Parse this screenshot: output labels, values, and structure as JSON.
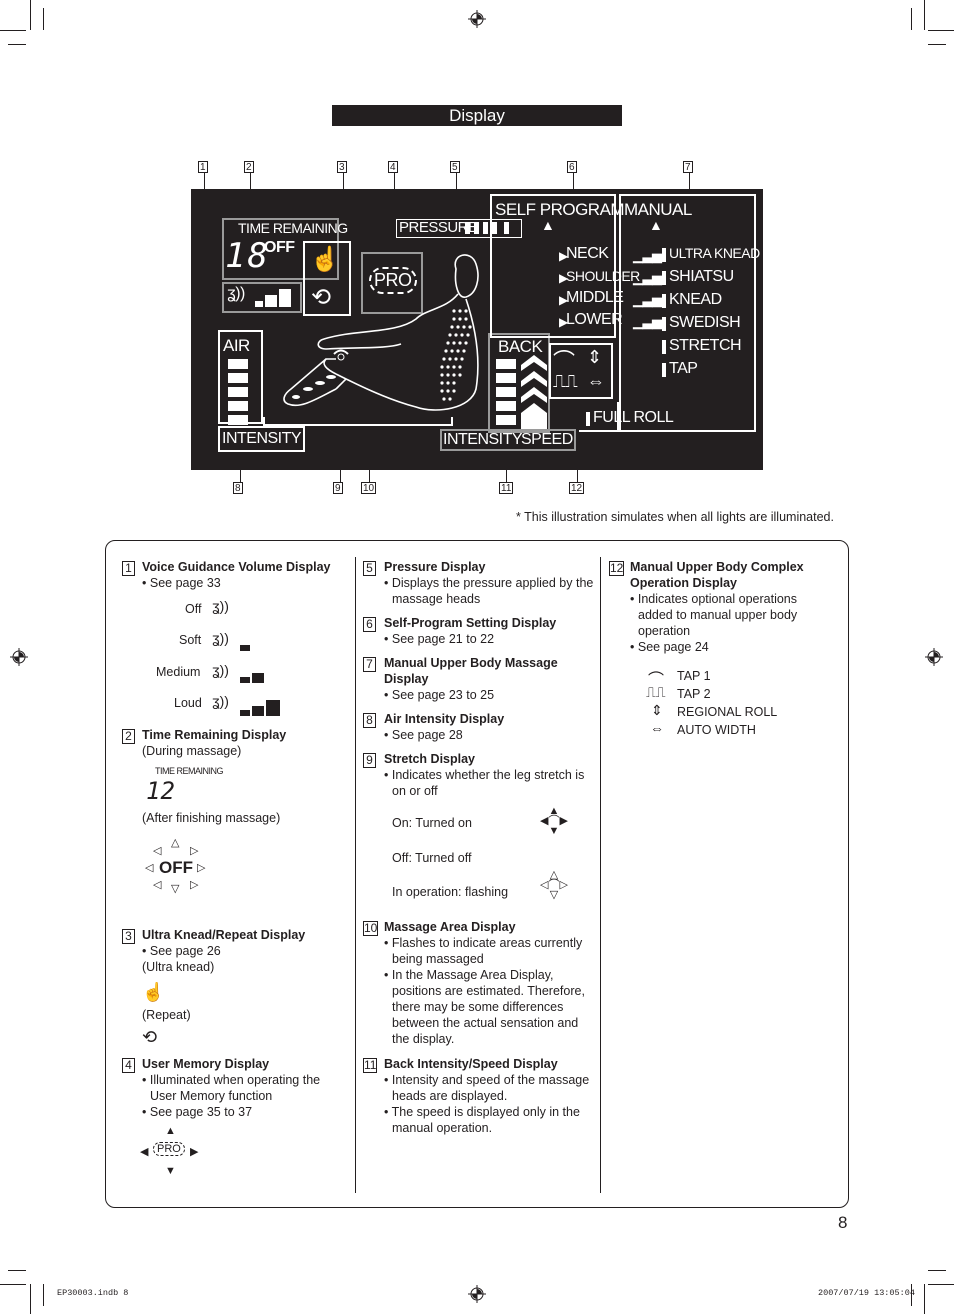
{
  "page": {
    "section_title": "Display",
    "page_number": "8",
    "note": "* This illustration simulates when all lights are illuminated.",
    "footer_left": "EP30003.indb   8",
    "footer_right": "2007/07/19   13:05:04"
  },
  "callouts": [
    "1",
    "2",
    "3",
    "4",
    "5",
    "6",
    "7",
    "8",
    "9",
    "10",
    "11",
    "12"
  ],
  "lcd": {
    "time_remaining_label": "TIME REMAINING",
    "time_digits": "18",
    "off_label": "OFF",
    "pressure_label": "PRESSURE",
    "pro_label": "PRO",
    "self_program_label": "SELF PROGRAM",
    "manual_label": "MANUAL",
    "self_program_areas": [
      "NECK",
      "SHOULDER",
      "MIDDLE",
      "LOWER"
    ],
    "manual_modes": [
      "ULTRA KNEAD",
      "SHIATSU",
      "KNEAD",
      "SWEDISH",
      "STRETCH",
      "TAP"
    ],
    "full_roll_label": "FULL ROLL",
    "air_label": "AIR",
    "air_intensity_label": "INTENSITY",
    "back_label": "BACK",
    "back_intensity_label": "INTENSITY",
    "back_speed_label": "SPEED",
    "voice_volume_level": "3 of 3",
    "pressure_level": "5 of 5",
    "air_intensity_level": "5 of 5",
    "back_intensity_level": "5 of 5",
    "back_speed_level": "4 of 4"
  },
  "legend": {
    "col1": [
      {
        "num": "1",
        "title": "Voice Guidance Volume Display",
        "bullets": [
          "See page 33"
        ],
        "levels": [
          {
            "label": "Off",
            "bars": 0
          },
          {
            "label": "Soft",
            "bars": 1
          },
          {
            "label": "Medium",
            "bars": 2
          },
          {
            "label": "Loud",
            "bars": 3
          }
        ]
      },
      {
        "num": "2",
        "title": "Time Remaining Display",
        "sub1": "(During massage)",
        "mini_label": "TIME REMAINING",
        "mini_digits": "12",
        "sub2": "(After finishing massage)",
        "off_label": "OFF"
      },
      {
        "num": "3",
        "title": "Ultra Knead/Repeat Display",
        "bullets": [
          "See page 26"
        ],
        "sub1": "(Ultra knead)",
        "sub2": "(Repeat)"
      },
      {
        "num": "4",
        "title": "User Memory Display",
        "bullets": [
          "Illuminated when operating the User Memory function",
          "See page 35 to 37"
        ],
        "pro_label": "PRO"
      }
    ],
    "col2": [
      {
        "num": "5",
        "title": "Pressure Display",
        "bullets": [
          "Displays the pressure applied by the massage heads"
        ]
      },
      {
        "num": "6",
        "title": "Self-Program Setting Display",
        "bullets": [
          "See page 21 to 22"
        ]
      },
      {
        "num": "7",
        "title": "Manual Upper Body Massage Display",
        "bullets": [
          "See page 23 to 25"
        ]
      },
      {
        "num": "8",
        "title": "Air Intensity Display",
        "bullets": [
          "See page 28"
        ]
      },
      {
        "num": "9",
        "title": "Stretch Display",
        "bullets": [
          "Indicates whether the leg stretch is on or off"
        ],
        "states": [
          "On: Turned on",
          "Off: Turned off",
          "In operation: flashing"
        ]
      },
      {
        "num": "10",
        "title": "Massage Area Display",
        "bullets": [
          "Flashes to indicate areas currently being massaged",
          "In the Massage Area Display, positions are estimated. Therefore, there may be some differences between the actual sensation and the display."
        ]
      },
      {
        "num": "11",
        "title": "Back Intensity/Speed Display",
        "bullets": [
          "Intensity and speed of the massage heads are displayed.",
          "The speed is displayed only in the manual operation."
        ]
      }
    ],
    "col3": [
      {
        "num": "12",
        "title": "Manual Upper Body Complex Operation Display",
        "bullets": [
          "Indicates optional operations added to manual upper body operation",
          "See page 24"
        ],
        "options": [
          {
            "icon": "tap1-wave-icon",
            "label": "TAP 1"
          },
          {
            "icon": "tap2-square-wave-icon",
            "label": "TAP 2"
          },
          {
            "icon": "regional-roll-icon",
            "label": "REGIONAL ROLL"
          },
          {
            "icon": "auto-width-icon",
            "label": "AUTO WIDTH"
          }
        ]
      }
    ]
  }
}
